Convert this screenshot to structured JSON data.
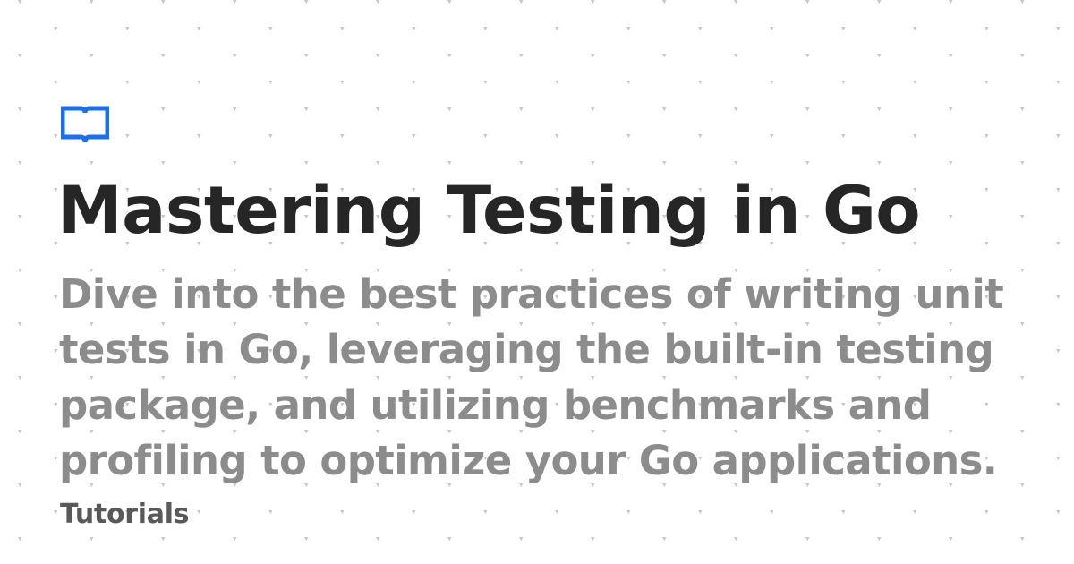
{
  "logo": {
    "icon": "open-book-icon",
    "color": "#1a6ff0"
  },
  "title": "Mastering Testing in Go",
  "description_lines": [
    "Dive into the best practices of writing unit",
    "tests in Go, leveraging the built-in testing",
    "package, and utilizing benchmarks and",
    "profiling to optimize your Go applications."
  ],
  "category": "Tutorials",
  "colors": {
    "background": "#ffffff",
    "title": "#262626",
    "description": "#8c8c8c",
    "category": "#595959",
    "pattern_dots": "#c8c8c8"
  }
}
